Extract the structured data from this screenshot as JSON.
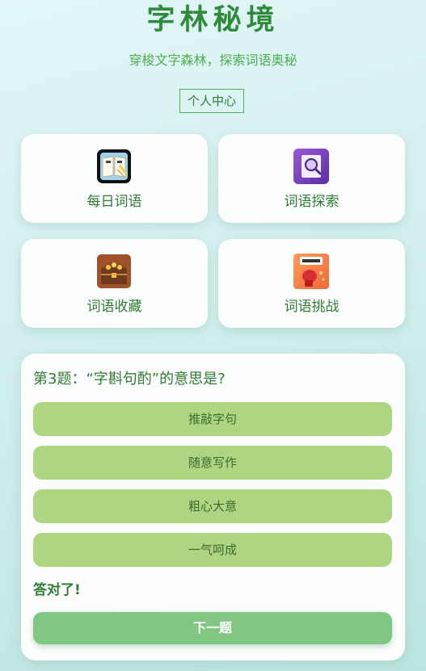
{
  "header": {
    "title": "字林秘境",
    "subtitle": "穿梭文字森林，探索词语奥秘",
    "profile_label": "个人中心"
  },
  "menu": {
    "items": [
      {
        "label": "每日词语",
        "icon": "book-icon"
      },
      {
        "label": "词语探索",
        "icon": "magnifier-icon"
      },
      {
        "label": "词语收藏",
        "icon": "treasure-chest-icon"
      },
      {
        "label": "词语挑战",
        "icon": "boxing-glove-icon"
      }
    ]
  },
  "quiz": {
    "question": "第3题：“字斟句酌”的意思是?",
    "options": [
      "推敲字句",
      "随意写作",
      "粗心大意",
      "一气呵成"
    ],
    "feedback": "答对了!",
    "next_label": "下一题"
  },
  "colors": {
    "accent": "#2e7d32",
    "option_bg": "#aed581",
    "next_bg": "#81c784"
  }
}
